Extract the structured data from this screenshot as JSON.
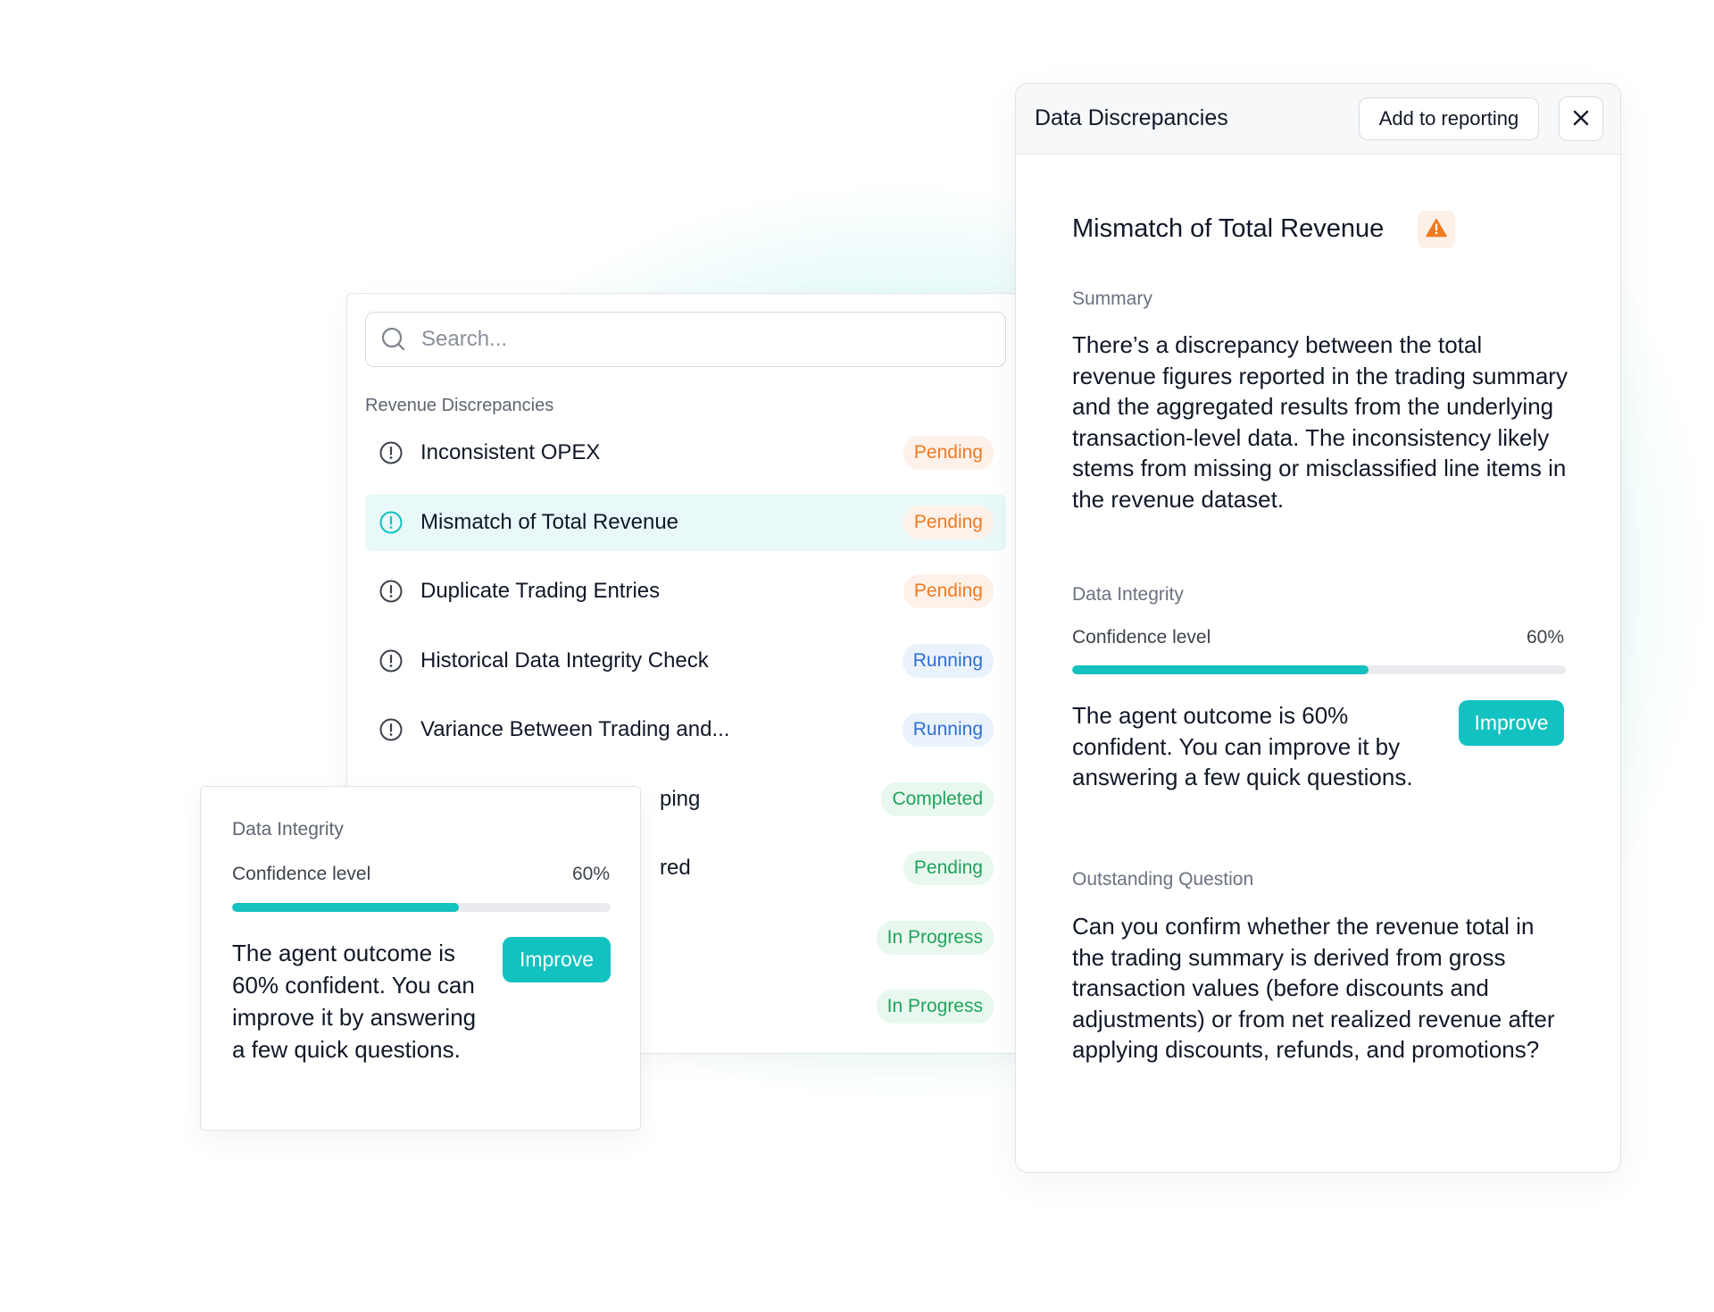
{
  "list_panel": {
    "search_placeholder": "Search...",
    "group_label": "Revenue Discrepancies",
    "items": [
      {
        "label": "Inconsistent OPEX",
        "status": "Pending"
      },
      {
        "label": "Mismatch of Total Revenue",
        "status": "Pending"
      },
      {
        "label": "Duplicate Trading Entries",
        "status": "Pending"
      },
      {
        "label": "Historical Data Integrity Check",
        "status": "Running"
      },
      {
        "label": "Variance Between Trading and...",
        "status": "Running"
      },
      {
        "label": "ping",
        "status": "Completed"
      },
      {
        "label": "red",
        "status": "Pending"
      },
      {
        "label": "",
        "status": "In Progress"
      },
      {
        "label": "",
        "status": "In Progress"
      }
    ]
  },
  "integrity_card": {
    "title": "Data Integrity",
    "confidence_label": "Confidence level",
    "confidence_value": "60%",
    "confidence_fraction": 0.6,
    "text": "The agent outcome is 60% confident. You can improve it by answering a few quick questions.",
    "improve_label": "Improve"
  },
  "detail_panel": {
    "header_title": "Data Discrepancies",
    "add_button": "Add to reporting",
    "heading": "Mismatch of Total Revenue",
    "summary_label": "Summary",
    "summary_text": "There’s a discrepancy between the total revenue figures reported in the trading summary and the aggregated results from the underlying transaction-level data. The inconsistency likely stems from missing or misclassified line items in the revenue dataset.",
    "integrity_label": "Data Integrity",
    "confidence_label": "Confidence level",
    "confidence_value": "60%",
    "confidence_fraction": 0.6,
    "agent_text": "The agent outcome is 60% confident. You can improve it by answering a few quick questions.",
    "improve_label": "Improve",
    "question_label": "Outstanding Question",
    "question_text": "Can you confirm whether the revenue total in the trading summary is derived from gross transaction values (before discounts and adjustments) or from net realized revenue after applying discounts, refunds, and promotions?"
  },
  "colors": {
    "accent": "#12c2c0",
    "pending": "#f07a22",
    "running": "#2f6fd6",
    "success": "#1fa35c",
    "warning": "#f07a22"
  },
  "icons": {
    "search": "search-icon",
    "alert": "alert-circle-icon",
    "close": "close-icon",
    "warning": "warning-triangle-icon"
  }
}
